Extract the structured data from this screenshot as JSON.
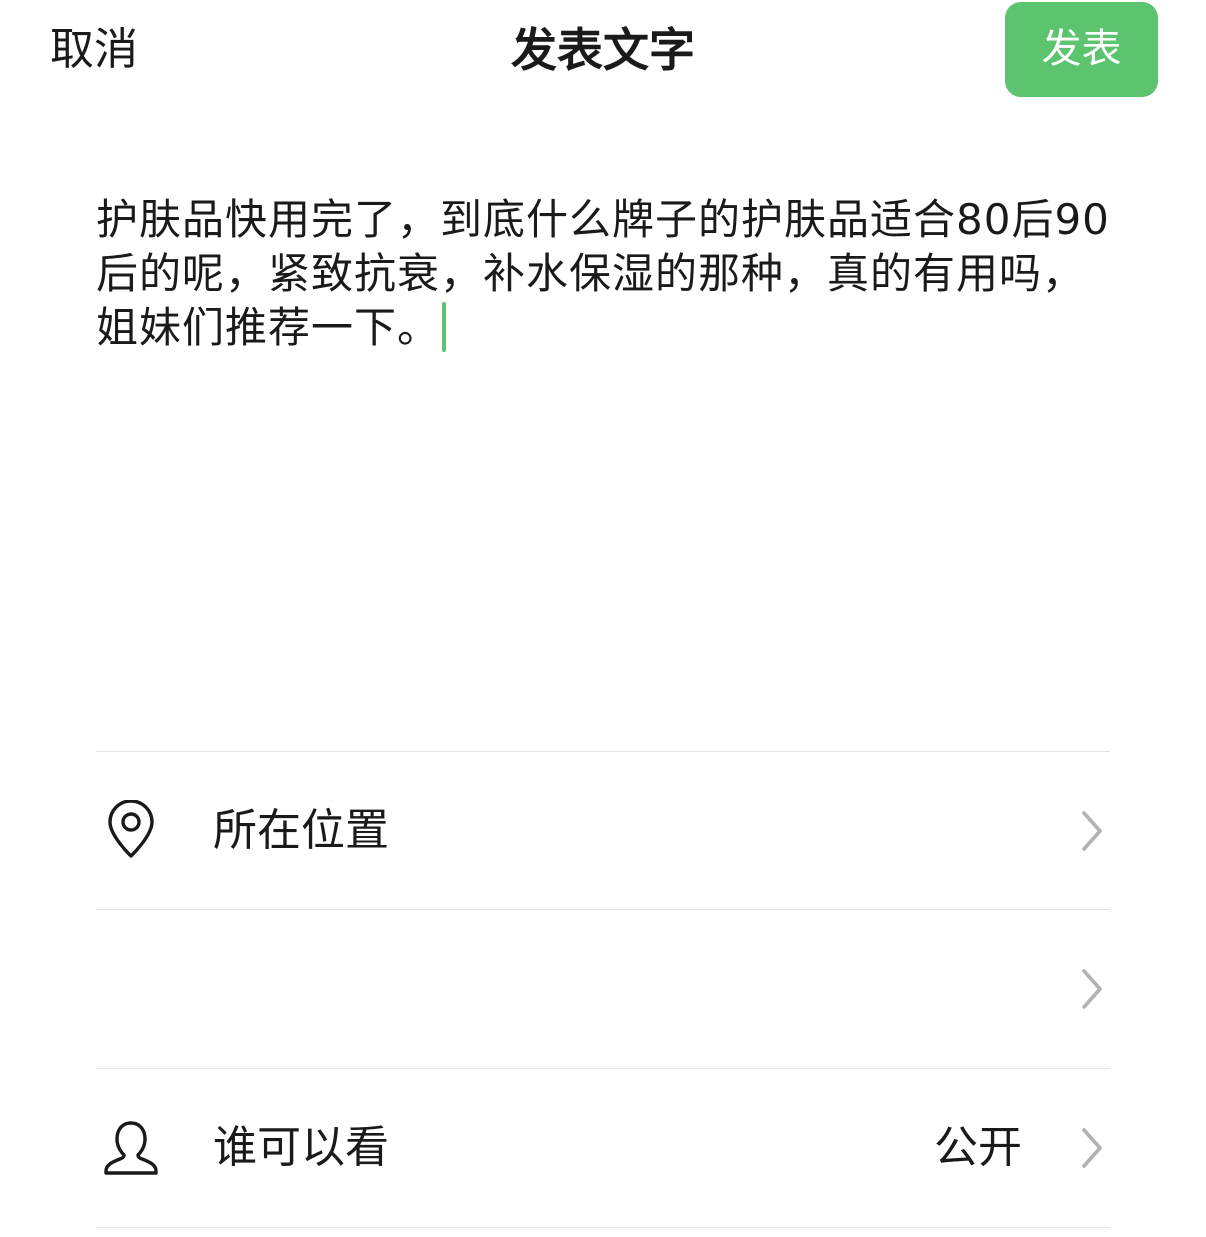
{
  "nav": {
    "cancel_label": "取消",
    "title": "发表文字",
    "publish_label": "发表"
  },
  "editor": {
    "text": "护肤品快用完了，到底什么牌子的护肤品适合80后90后的呢，紧致抗衰，补水保湿的那种，真的有用吗，姐妹们推荐一下。"
  },
  "options": {
    "location": {
      "label": "所在位置",
      "icon": "location-pin-icon"
    },
    "empty_row": {
      "label": ""
    },
    "visibility": {
      "label": "谁可以看",
      "value": "公开",
      "icon": "user-icon"
    }
  },
  "colors": {
    "accent": "#5cc46e",
    "divider": "#e3e3e3",
    "chevron": "#b2b2b2"
  }
}
